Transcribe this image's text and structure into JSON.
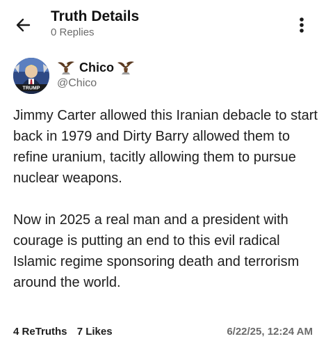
{
  "header": {
    "title": "Truth Details",
    "subtitle": "0 Replies",
    "back_icon": "arrow-left-icon",
    "more_icon": "vertical-ellipsis-icon"
  },
  "author": {
    "display_name": "Chico",
    "decoration_icon": "eagle-icon",
    "handle": "@Chico",
    "avatar_caption": "TRUMP"
  },
  "post": {
    "paragraphs": [
      "Jimmy Carter allowed this Iranian debacle to start back in 1979 and Dirty Barry allowed them to refine uranium, tacitly allowing them to pursue nuclear weapons.",
      "Now in 2025 a real man and a president with courage is putting an end to this evil radical Islamic regime sponsoring death and terrorism around the world."
    ]
  },
  "stats": {
    "retruths_count": "4",
    "retruths_label": "ReTruths",
    "likes_count": "7",
    "likes_label": "Likes",
    "timestamp": "6/22/25, 12:24 AM"
  },
  "colors": {
    "text_primary": "#1a1a1a",
    "text_secondary": "#6b6b6b",
    "background": "#ffffff"
  }
}
